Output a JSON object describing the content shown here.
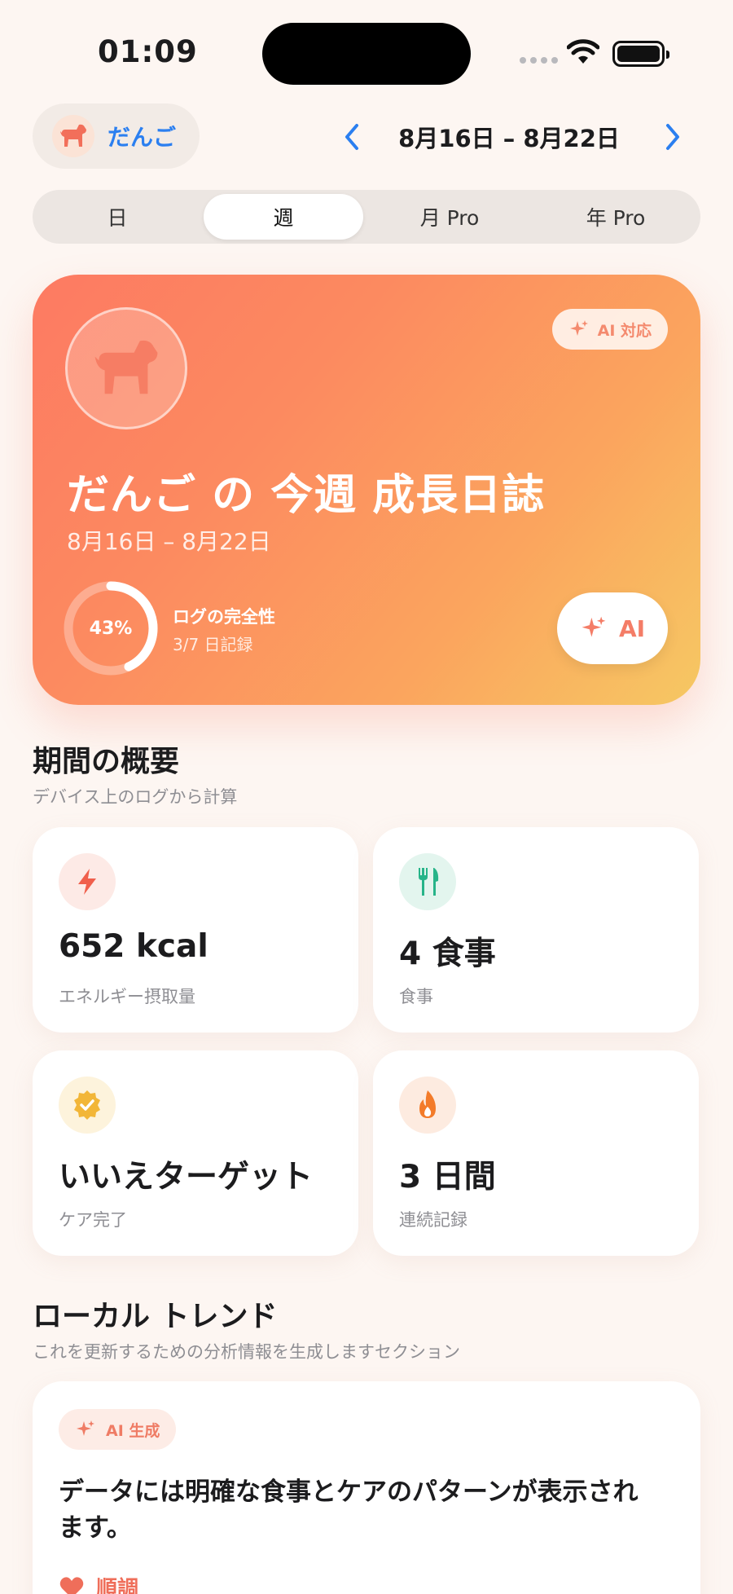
{
  "status_bar": {
    "time": "01:09"
  },
  "header": {
    "pet_name": "だんご",
    "date_range": "8月16日 – 8月22日"
  },
  "segments": [
    {
      "label": "日",
      "selected": false
    },
    {
      "label": "週",
      "selected": true
    },
    {
      "label": "月 Pro",
      "selected": false
    },
    {
      "label": "年 Pro",
      "selected": false
    }
  ],
  "hero": {
    "ai_badge": "AI 対応",
    "title": "だんご の 今週 成長日誌",
    "date_range": "8月16日 – 8月22日",
    "completeness_percent": 43,
    "completeness_text": "43%",
    "completeness_label": "ログの完全性",
    "completeness_sub": "3/7 日記録",
    "ai_button": "AI"
  },
  "summary": {
    "title": "期間の概要",
    "subtitle": "デバイス上のログから計算",
    "cards": [
      {
        "value": "652 kcal",
        "label": "エネルギー摂取量",
        "icon": "bolt-icon"
      },
      {
        "value": "4 食事",
        "label": "食事",
        "icon": "fork-knife-icon"
      },
      {
        "value": "いいえターゲット",
        "label": "ケア完了",
        "icon": "check-badge-icon"
      },
      {
        "value": "3 日間",
        "label": "連続記録",
        "icon": "flame-icon"
      }
    ]
  },
  "trend": {
    "title": "ローカル トレンド",
    "subtitle": "これを更新するための分析情報を生成しますセクション",
    "badge": "AI 生成",
    "text": "データには明確な食事とケアのパターンが表示されます。",
    "status": "順調"
  },
  "colors": {
    "accent_blue": "#2b7ff0",
    "coral": "#fd7a62",
    "gradient_end": "#f6c863",
    "background": "#fdf6f2"
  }
}
